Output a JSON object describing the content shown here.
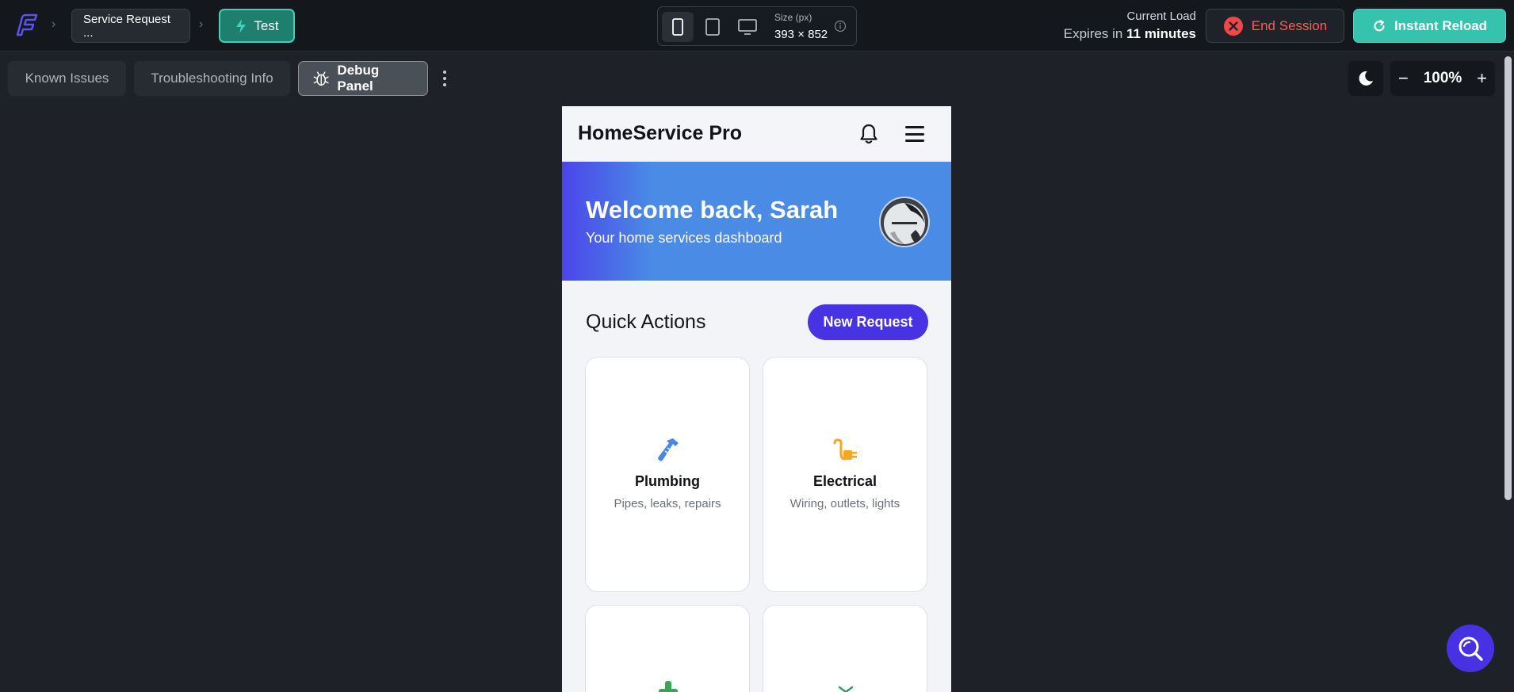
{
  "topbar": {
    "logo_icon": "flutterflow-logo-icon",
    "breadcrumb_project": "Service Request ...",
    "test_label": "Test",
    "device_size_label": "Size (px)",
    "device_size_value": "393 × 852",
    "load_label": "Current Load",
    "expires_prefix": "Expires in",
    "expires_value": "11 minutes",
    "end_session_label": "End Session",
    "instant_reload_label": "Instant Reload"
  },
  "toolbar": {
    "tabs": [
      {
        "label": "Known Issues"
      },
      {
        "label": "Troubleshooting Info"
      },
      {
        "label": "Debug Panel"
      }
    ],
    "zoom": "100%",
    "zoom_minus": "−",
    "zoom_plus": "+"
  },
  "app": {
    "title": "HomeService Pro",
    "hero_title": "Welcome back, Sarah",
    "hero_subtitle": "Your home services dashboard",
    "quick_actions_title": "Quick Actions",
    "new_request_label": "New Request",
    "services": [
      {
        "title": "Plumbing",
        "desc": "Pipes, leaks, repairs",
        "icon": "pipe-wrench-icon",
        "color": "#4a86e8"
      },
      {
        "title": "Electrical",
        "desc": "Wiring, outlets, lights",
        "icon": "plug-icon",
        "color": "#f5a623"
      },
      {
        "title": "",
        "desc": "",
        "icon": "green-tool-icon",
        "color": "#34a853"
      },
      {
        "title": "",
        "desc": "",
        "icon": "leaf-icon",
        "color": "#2e9e5b"
      }
    ]
  },
  "colors": {
    "accent_purple": "#4733e4",
    "accent_teal": "#35c3ae",
    "danger_red": "#ff5a5a",
    "hero_blue": "#4a8be6"
  }
}
